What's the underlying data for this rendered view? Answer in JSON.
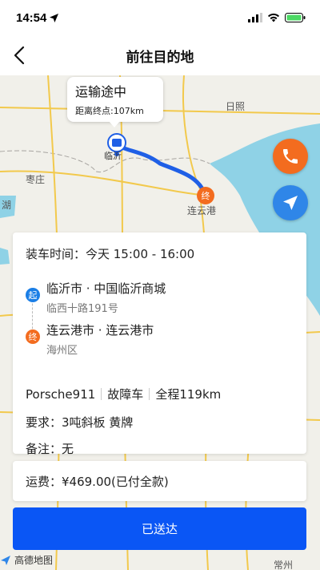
{
  "status": {
    "time": "14:54"
  },
  "nav": {
    "title": "前往目的地"
  },
  "map": {
    "places": [
      "日照",
      "枣庄",
      "连云港",
      "湖",
      "常州"
    ],
    "route_colors": {
      "route": "#1f5fe6",
      "sea": "#8fd2e6"
    },
    "bubble": {
      "title": "运输途中",
      "distance": "距离终点:107km"
    },
    "start_marker_label": "临沂",
    "end_marker_label": "终",
    "logo": "高德地图"
  },
  "order": {
    "loading_time": "装车时间：今天 15:00 - 16:00",
    "start": {
      "badge": "起",
      "name": "临沂市 · 中国临沂商城",
      "address": "临西十路191号"
    },
    "end": {
      "badge": "终",
      "name": "连云港市 · 连云港市",
      "address": "海州区"
    },
    "vehicle": "Porsche911",
    "vehicle_status": "故障车",
    "distance": "全程119km",
    "requirement": "要求：3吨斜板 黄牌",
    "remark": "备注：无"
  },
  "fee": {
    "label": "运费：¥469.00(已付全款)"
  },
  "action": {
    "label": "已送达"
  },
  "colors": {
    "primary": "#0a56f5",
    "start": "#1a7ee6",
    "end": "#f36c1f"
  }
}
